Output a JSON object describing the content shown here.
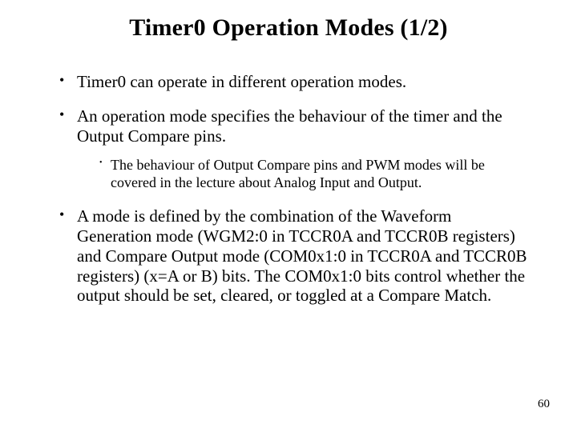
{
  "title": "Timer0 Operation Modes (1/2)",
  "bullets": {
    "b0": "Timer0 can operate in different operation modes.",
    "b1": "An operation mode specifies the behaviour of the timer and the Output Compare pins.",
    "b1_sub0": "The behaviour of Output Compare pins and PWM modes will be covered in the lecture about Analog Input and Output.",
    "b2": "A mode is defined by the combination of the Waveform Generation mode (WGM2:0 in TCCR0A and TCCR0B registers) and Compare Output mode (COM0x1:0 in TCCR0A and TCCR0B registers) (x=A or B) bits. The COM0x1:0 bits control whether the output should be set, cleared, or toggled at a Compare Match."
  },
  "page_number": "60"
}
